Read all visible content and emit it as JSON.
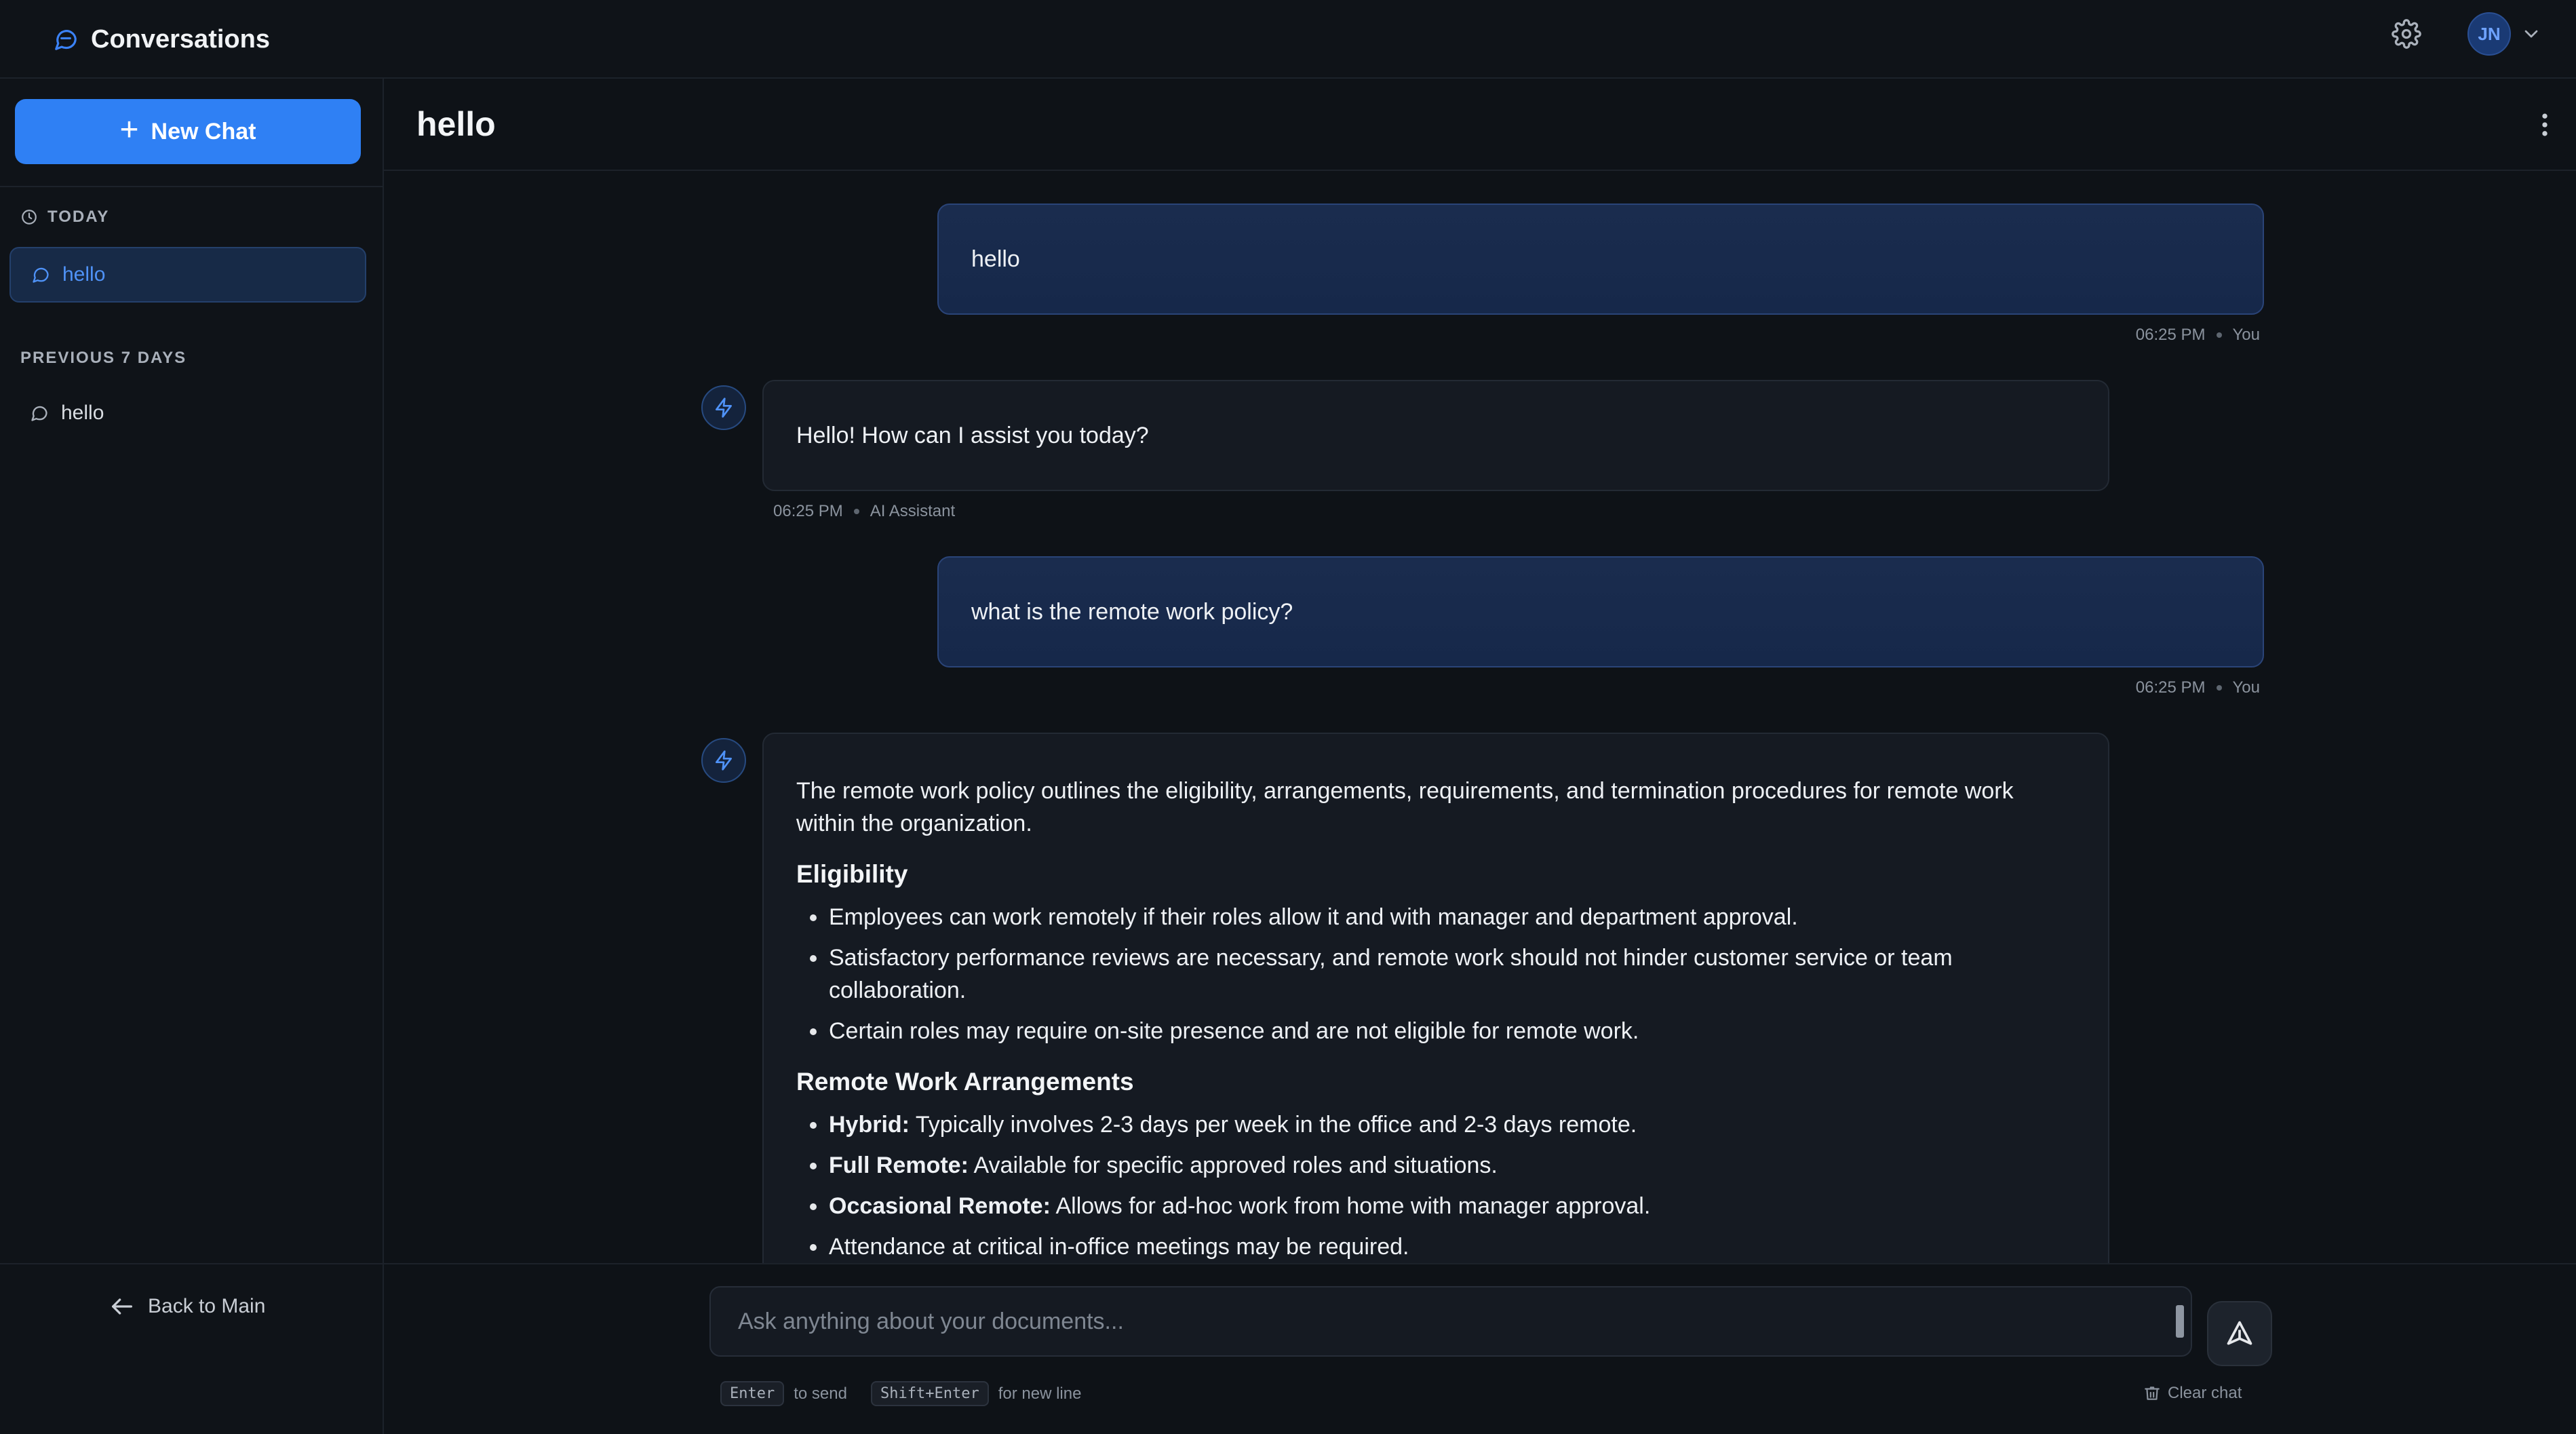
{
  "app": {
    "title": "Conversations"
  },
  "header": {
    "avatar_initials": "JN"
  },
  "sidebar": {
    "new_chat_label": "New Chat",
    "sections": [
      {
        "label": "TODAY",
        "items": [
          {
            "label": "hello",
            "active": true
          }
        ]
      },
      {
        "label": "PREVIOUS 7 DAYS",
        "items": [
          {
            "label": "hello",
            "active": false
          }
        ]
      }
    ],
    "back_label": "Back to Main"
  },
  "chat": {
    "title": "hello",
    "messages": [
      {
        "role": "user",
        "text": "hello",
        "time": "06:25 PM",
        "author": "You"
      },
      {
        "role": "assistant",
        "text": "Hello! How can I assist you today?",
        "time": "06:25 PM",
        "author": "AI Assistant"
      },
      {
        "role": "user",
        "text": "what is the remote work policy?",
        "time": "06:25 PM",
        "author": "You"
      },
      {
        "role": "assistant",
        "intro": "The remote work policy outlines the eligibility, arrangements, requirements, and termination procedures for remote work within the organization.",
        "sections": [
          {
            "heading": "Eligibility",
            "items": [
              {
                "bold": "",
                "text": "Employees can work remotely if their roles allow it and with manager and department approval."
              },
              {
                "bold": "",
                "text": "Satisfactory performance reviews are necessary, and remote work should not hinder customer service or team collaboration."
              },
              {
                "bold": "",
                "text": "Certain roles may require on-site presence and are not eligible for remote work."
              }
            ]
          },
          {
            "heading": "Remote Work Arrangements",
            "items": [
              {
                "bold": "Hybrid:",
                "text": " Typically involves 2-3 days per week in the office and 2-3 days remote."
              },
              {
                "bold": "Full Remote:",
                "text": " Available for specific approved roles and situations."
              },
              {
                "bold": "Occasional Remote:",
                "text": " Allows for ad-hoc work from home with manager approval."
              },
              {
                "bold": "",
                "text": "Attendance at critical in-office meetings may be required."
              }
            ]
          }
        ]
      }
    ]
  },
  "composer": {
    "placeholder": "Ask anything about your documents...",
    "value": "",
    "hint_send_key": "Enter",
    "hint_send_text": "to send",
    "hint_newline_key": "Shift+Enter",
    "hint_newline_text": "for new line",
    "clear_label": "Clear chat"
  },
  "colors": {
    "accent": "#2f80f4",
    "background": "#0e1217",
    "user_bubble": "#1a2c4e",
    "ai_bubble": "#151a22"
  },
  "icons": [
    "chat-bubble-icon",
    "gear-icon",
    "chevron-down-icon",
    "plus-icon",
    "clock-icon",
    "arrow-left-icon",
    "kebab-icon",
    "bolt-icon",
    "send-icon",
    "trash-icon"
  ]
}
